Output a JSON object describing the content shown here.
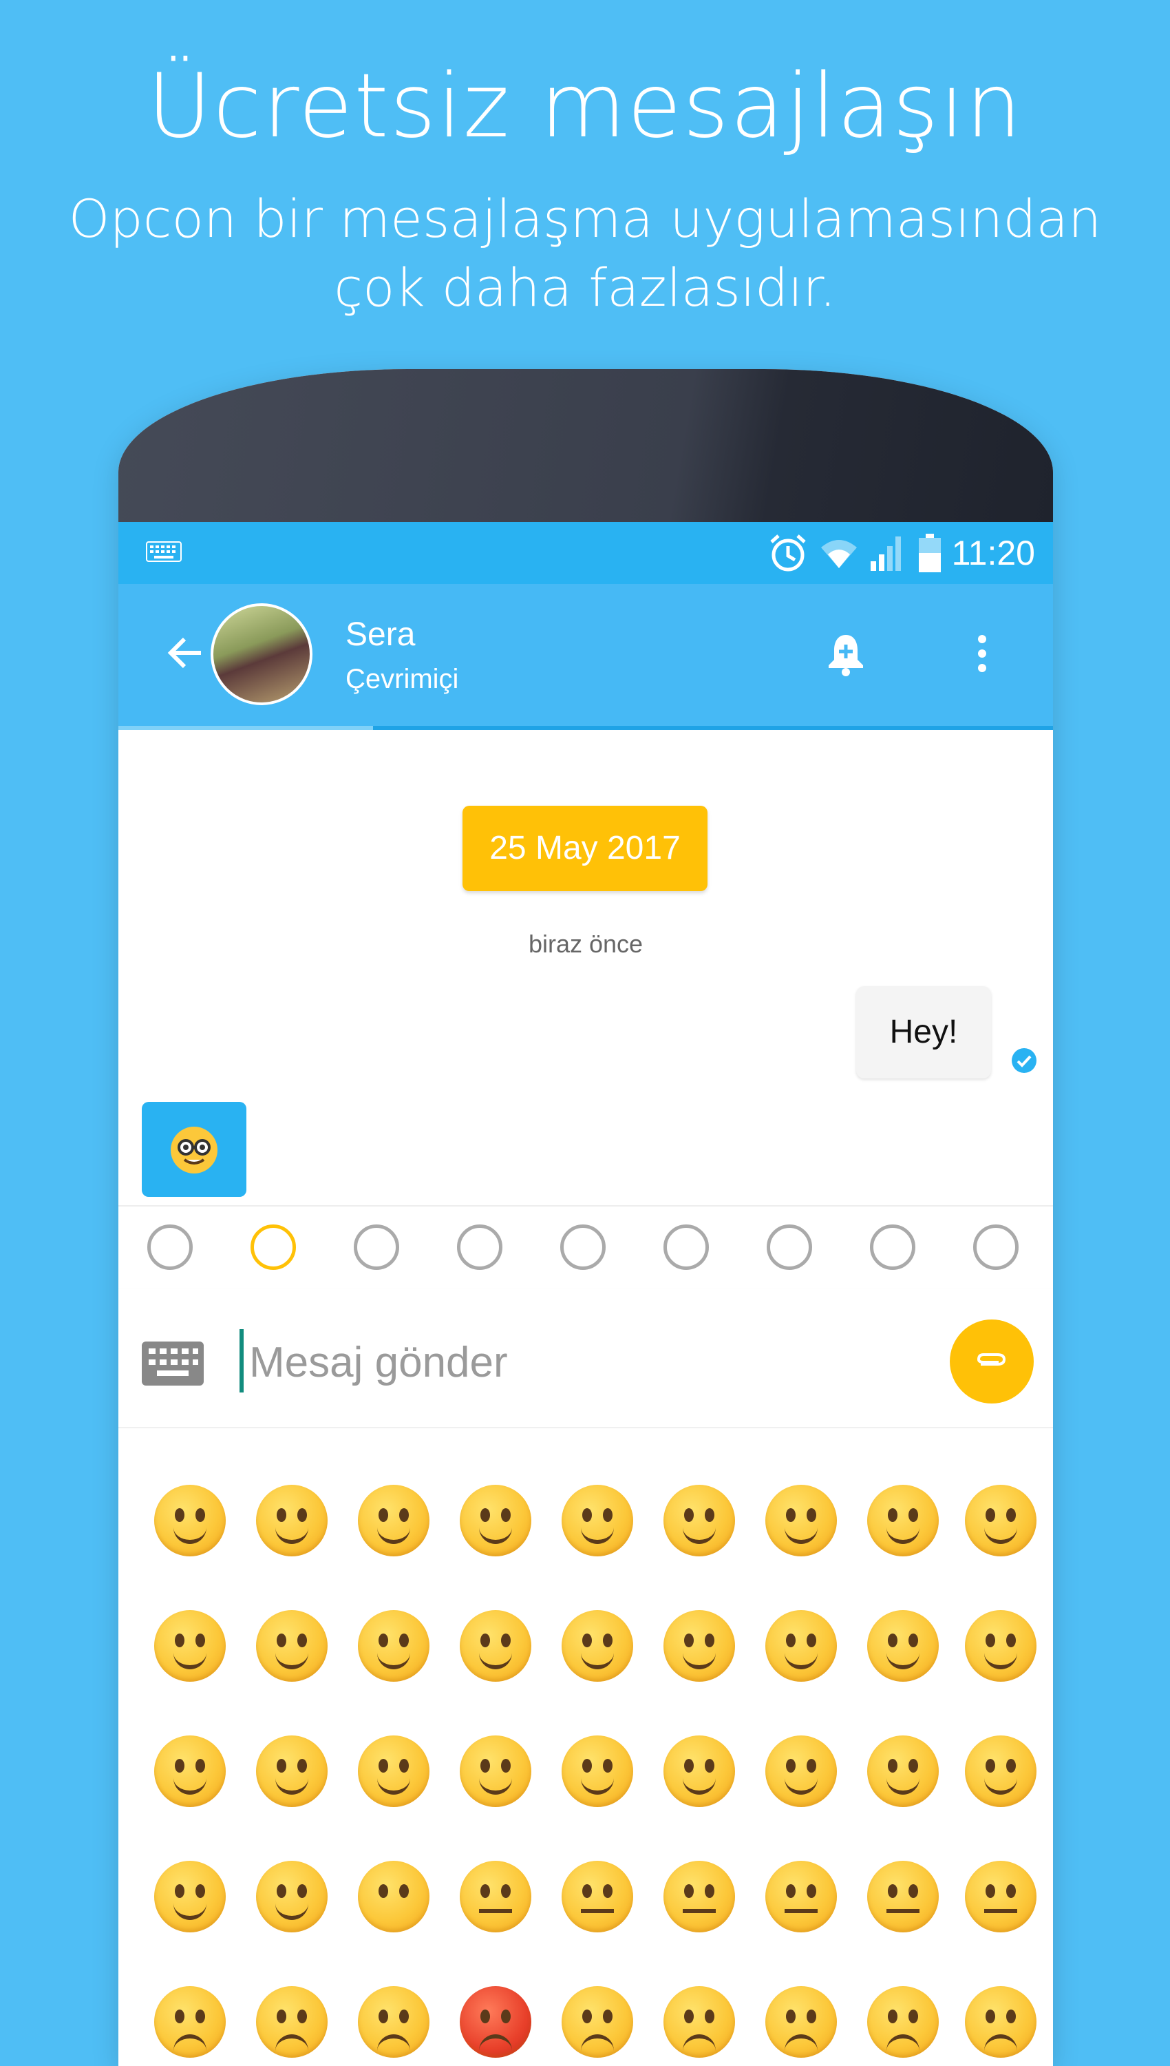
{
  "promo": {
    "title": "Ücretsiz mesajlaşın",
    "subtitle_line1": "Opcon bir mesajlaşma uygulamasından",
    "subtitle_line2": "çok daha fazlasıdır."
  },
  "status_bar": {
    "time": "11:20",
    "icons": [
      "keyboard-icon",
      "alarm-icon",
      "wifi-icon",
      "signal-icon",
      "battery-icon"
    ]
  },
  "chat_header": {
    "contact_name": "Sera",
    "contact_status": "Çevrimiçi",
    "icons": [
      "back-arrow-icon",
      "bell-plus-icon",
      "more-vert-icon"
    ]
  },
  "chat": {
    "date_chip": "25 May 2017",
    "time_label": "biraz önce",
    "outgoing_message": "Hey!",
    "incoming_message_emoji": "nerd-face"
  },
  "emoji_categories": [
    "recent-clock-icon",
    "paw-icon",
    "piggy-icon",
    "elephant-icon",
    "ball-icon",
    "sun-icon",
    "lamp-icon",
    "heart-icon",
    "tag-icon"
  ],
  "input": {
    "placeholder": "Mesaj gönder"
  },
  "colors": {
    "background": "#4fbef5",
    "status_bar": "#29b2f2",
    "header": "#46b9f5",
    "accent": "#ffc107"
  }
}
